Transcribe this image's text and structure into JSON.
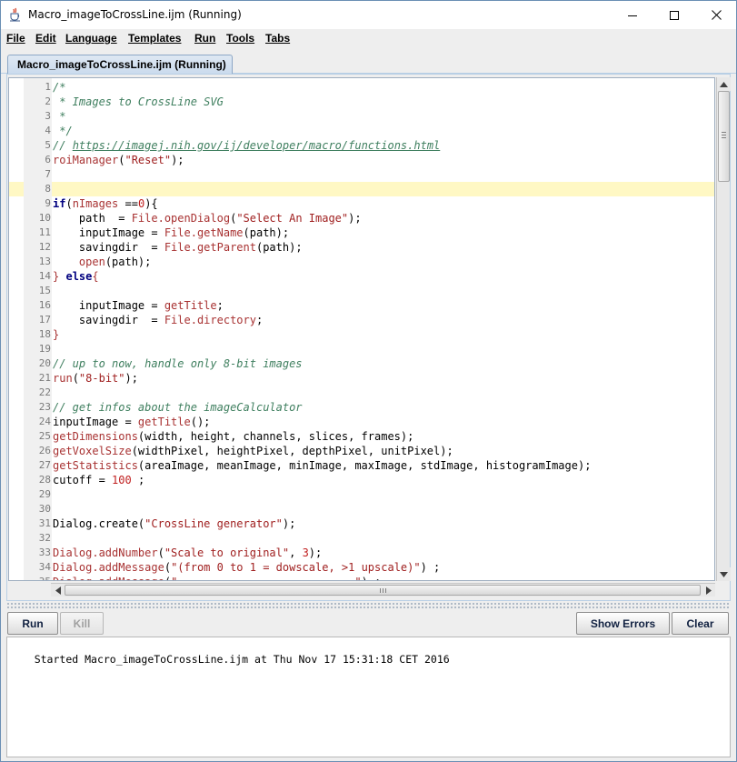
{
  "window": {
    "title": "Macro_imageToCrossLine.ijm (Running)"
  },
  "menu": {
    "items": [
      {
        "label": "File"
      },
      {
        "label": "Edit"
      },
      {
        "label": "Language"
      },
      {
        "label": "Templates"
      },
      {
        "label": "Run"
      },
      {
        "label": "Tools"
      },
      {
        "label": "Tabs"
      }
    ]
  },
  "tabs": [
    {
      "label": "Macro_imageToCrossLine.ijm (Running)",
      "selected": true
    }
  ],
  "editor": {
    "current_line": 8,
    "lines": [
      {
        "n": "1",
        "tokens": [
          {
            "t": "cm",
            "s": "/*"
          }
        ]
      },
      {
        "n": "2",
        "tokens": [
          {
            "t": "cm",
            "s": " * Images to CrossLine SVG"
          }
        ]
      },
      {
        "n": "3",
        "tokens": [
          {
            "t": "cm",
            "s": " *"
          }
        ]
      },
      {
        "n": "4",
        "tokens": [
          {
            "t": "cm",
            "s": " */"
          }
        ]
      },
      {
        "n": "5",
        "tokens": [
          {
            "t": "cm",
            "s": "// "
          },
          {
            "t": "url",
            "s": "https://imagej.nih.gov/ij/developer/macro/functions.html"
          }
        ]
      },
      {
        "n": "6",
        "tokens": [
          {
            "t": "fn",
            "s": "roiManager"
          },
          {
            "t": "pl",
            "s": "("
          },
          {
            "t": "str",
            "s": "\"Reset\""
          },
          {
            "t": "pl",
            "s": ");"
          }
        ]
      },
      {
        "n": "7",
        "tokens": []
      },
      {
        "n": "8",
        "tokens": []
      },
      {
        "n": "9",
        "tokens": [
          {
            "t": "kw",
            "s": "if"
          },
          {
            "t": "pl",
            "s": "("
          },
          {
            "t": "fn",
            "s": "nImages"
          },
          {
            "t": "pl",
            "s": " =="
          },
          {
            "t": "num",
            "s": "0"
          },
          {
            "t": "pl",
            "s": "){"
          }
        ]
      },
      {
        "n": "10",
        "tokens": [
          {
            "t": "pl",
            "s": "    path  = "
          },
          {
            "t": "fn",
            "s": "File.openDialog"
          },
          {
            "t": "pl",
            "s": "("
          },
          {
            "t": "str",
            "s": "\"Select An Image\""
          },
          {
            "t": "pl",
            "s": ");"
          }
        ]
      },
      {
        "n": "11",
        "tokens": [
          {
            "t": "pl",
            "s": "    inputImage = "
          },
          {
            "t": "fn",
            "s": "File.getName"
          },
          {
            "t": "pl",
            "s": "(path);"
          }
        ]
      },
      {
        "n": "12",
        "tokens": [
          {
            "t": "pl",
            "s": "    savingdir  = "
          },
          {
            "t": "fn",
            "s": "File.getParent"
          },
          {
            "t": "pl",
            "s": "(path);"
          }
        ]
      },
      {
        "n": "13",
        "tokens": [
          {
            "t": "pl",
            "s": "    "
          },
          {
            "t": "fn",
            "s": "open"
          },
          {
            "t": "pl",
            "s": "(path);"
          }
        ]
      },
      {
        "n": "14",
        "tokens": [
          {
            "t": "fn",
            "s": "}"
          },
          {
            "t": "pl",
            "s": " "
          },
          {
            "t": "kw",
            "s": "else"
          },
          {
            "t": "fn",
            "s": "{"
          }
        ]
      },
      {
        "n": "15",
        "tokens": []
      },
      {
        "n": "16",
        "tokens": [
          {
            "t": "pl",
            "s": "    inputImage = "
          },
          {
            "t": "fn",
            "s": "getTitle"
          },
          {
            "t": "pl",
            "s": ";"
          }
        ]
      },
      {
        "n": "17",
        "tokens": [
          {
            "t": "pl",
            "s": "    savingdir  = "
          },
          {
            "t": "fn",
            "s": "File.directory"
          },
          {
            "t": "pl",
            "s": ";"
          }
        ]
      },
      {
        "n": "18",
        "tokens": [
          {
            "t": "fn",
            "s": "}"
          }
        ]
      },
      {
        "n": "19",
        "tokens": []
      },
      {
        "n": "20",
        "tokens": [
          {
            "t": "cm",
            "s": "// up to now, handle only 8-bit images"
          }
        ]
      },
      {
        "n": "21",
        "tokens": [
          {
            "t": "fn",
            "s": "run"
          },
          {
            "t": "pl",
            "s": "("
          },
          {
            "t": "str",
            "s": "\"8-bit\""
          },
          {
            "t": "pl",
            "s": ");"
          }
        ]
      },
      {
        "n": "22",
        "tokens": []
      },
      {
        "n": "23",
        "tokens": [
          {
            "t": "cm",
            "s": "// get infos about the imageCalculator"
          }
        ]
      },
      {
        "n": "24",
        "tokens": [
          {
            "t": "pl",
            "s": "inputImage = "
          },
          {
            "t": "fn",
            "s": "getTitle"
          },
          {
            "t": "pl",
            "s": "();"
          }
        ]
      },
      {
        "n": "25",
        "tokens": [
          {
            "t": "fn",
            "s": "getDimensions"
          },
          {
            "t": "pl",
            "s": "(width, height, channels, slices, frames);"
          }
        ]
      },
      {
        "n": "26",
        "tokens": [
          {
            "t": "fn",
            "s": "getVoxelSize"
          },
          {
            "t": "pl",
            "s": "(widthPixel, heightPixel, depthPixel, unitPixel);"
          }
        ]
      },
      {
        "n": "27",
        "tokens": [
          {
            "t": "fn",
            "s": "getStatistics"
          },
          {
            "t": "pl",
            "s": "(areaImage, meanImage, minImage, maxImage, stdImage, histogramImage);"
          }
        ]
      },
      {
        "n": "28",
        "tokens": [
          {
            "t": "pl",
            "s": "cutoff = "
          },
          {
            "t": "num",
            "s": "100"
          },
          {
            "t": "pl",
            "s": " ;"
          }
        ]
      },
      {
        "n": "29",
        "tokens": []
      },
      {
        "n": "30",
        "tokens": []
      },
      {
        "n": "31",
        "tokens": [
          {
            "t": "pl",
            "s": "Dialog.create("
          },
          {
            "t": "str",
            "s": "\"CrossLine generator\""
          },
          {
            "t": "pl",
            "s": ");"
          }
        ]
      },
      {
        "n": "32",
        "tokens": []
      },
      {
        "n": "33",
        "tokens": [
          {
            "t": "fn",
            "s": "Dialog.addNumber"
          },
          {
            "t": "pl",
            "s": "("
          },
          {
            "t": "str",
            "s": "\"Scale to original\""
          },
          {
            "t": "pl",
            "s": ", "
          },
          {
            "t": "num",
            "s": "3"
          },
          {
            "t": "pl",
            "s": ");"
          }
        ]
      },
      {
        "n": "34",
        "tokens": [
          {
            "t": "fn",
            "s": "Dialog.addMessage"
          },
          {
            "t": "pl",
            "s": "("
          },
          {
            "t": "str",
            "s": "\"(from 0 to 1 = dowscale, >1 upscale)\""
          },
          {
            "t": "pl",
            "s": ") ;"
          }
        ]
      },
      {
        "n": "35",
        "tokens": [
          {
            "t": "fn",
            "s": "Dialog.addMessage"
          },
          {
            "t": "pl",
            "s": "("
          },
          {
            "t": "str",
            "s": "\"---------------------------\""
          },
          {
            "t": "pl",
            "s": ") ;"
          }
        ]
      }
    ]
  },
  "buttons": {
    "run": "Run",
    "kill": "Kill",
    "show_errors": "Show Errors",
    "clear": "Clear"
  },
  "output": {
    "text": "Started Macro_imageToCrossLine.ijm at Thu Nov 17 15:31:18 CET 2016"
  },
  "colors": {
    "comment": "#3f7f5f",
    "function": "#a83232",
    "string": "#a02020",
    "keyword": "#00007f",
    "current_line": "#fff8c4"
  }
}
